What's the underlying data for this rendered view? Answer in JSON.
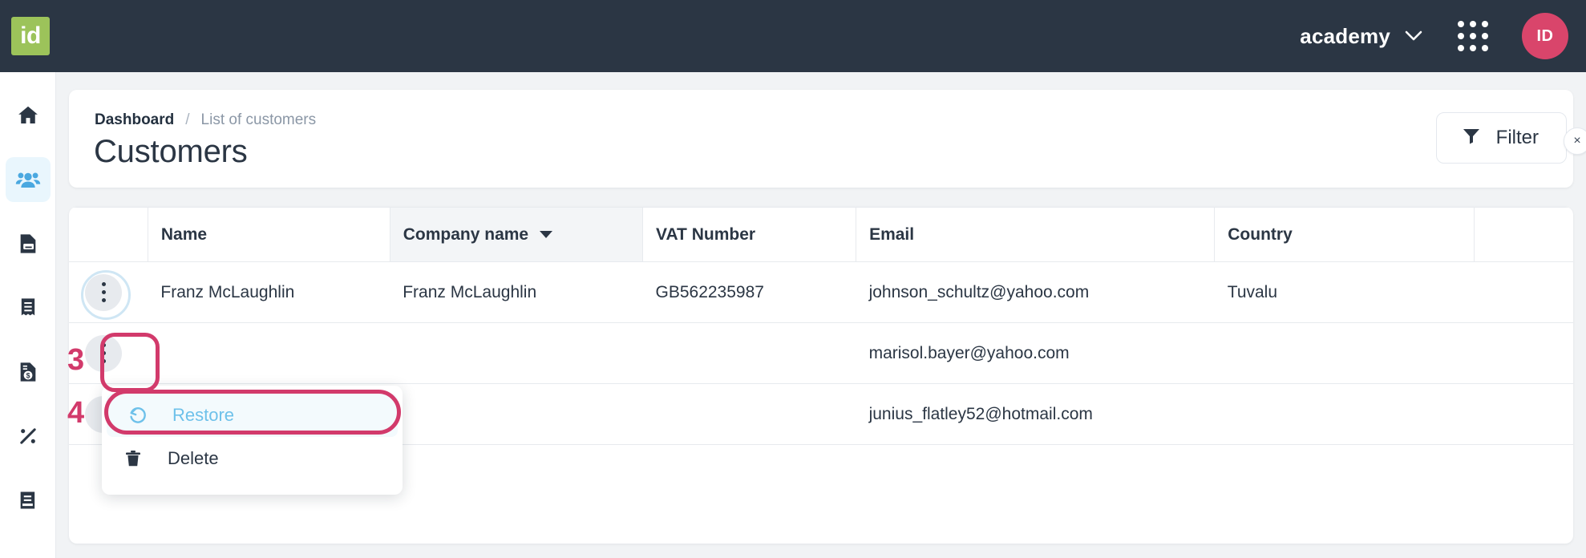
{
  "topbar": {
    "logo_text": "id",
    "org_name": "academy",
    "org_chevron_icon": "chevron-down-icon",
    "apps_icon": "grid-apps-icon",
    "avatar_initials": "ID",
    "avatar_color": "#d9456b",
    "logo_color": "#9cc35a",
    "background_color": "#2b3644"
  },
  "sidebar": {
    "items": [
      {
        "name": "home",
        "icon": "home-icon",
        "active": false
      },
      {
        "name": "customers",
        "icon": "people-icon",
        "active": true
      },
      {
        "name": "quotes",
        "icon": "document-icon",
        "active": false
      },
      {
        "name": "receipts",
        "icon": "receipt-icon",
        "active": false
      },
      {
        "name": "invoices",
        "icon": "invoice-dollar-icon",
        "active": false
      },
      {
        "name": "taxes",
        "icon": "percent-icon",
        "active": false
      },
      {
        "name": "ledger",
        "icon": "book-icon",
        "active": false
      }
    ],
    "active_color": "#4aa8e0",
    "active_background": "#e9f6fd"
  },
  "header": {
    "breadcrumb": {
      "root": "Dashboard",
      "separator": "/",
      "current": "List of customers"
    },
    "title": "Customers",
    "filter_button": {
      "label": "Filter",
      "icon": "funnel-icon",
      "clear_icon": "close-icon",
      "clear_label": "×"
    }
  },
  "table": {
    "columns": [
      {
        "key": "actions",
        "label": ""
      },
      {
        "key": "name",
        "label": "Name",
        "sorted": false
      },
      {
        "key": "company",
        "label": "Company name",
        "sorted": true,
        "sort_icon": "sort-desc-caret"
      },
      {
        "key": "vat",
        "label": "VAT Number",
        "sorted": false
      },
      {
        "key": "email",
        "label": "Email",
        "sorted": false
      },
      {
        "key": "country",
        "label": "Country",
        "sorted": false
      }
    ],
    "rows": [
      {
        "actions_icon": "kebab-menu-icon",
        "name": "Franz McLaughlin",
        "company": "Franz McLaughlin",
        "vat": "GB562235987",
        "email": "johnson_schultz@yahoo.com",
        "country": "Tuvalu"
      },
      {
        "actions_icon": "kebab-menu-icon",
        "name": "",
        "company": "",
        "vat": "",
        "email": "marisol.bayer@yahoo.com",
        "country": ""
      },
      {
        "actions_icon": "kebab-menu-icon",
        "name": "",
        "company": "",
        "vat": "",
        "email": "junius_flatley52@hotmail.com",
        "country": ""
      }
    ]
  },
  "context_menu": {
    "items": [
      {
        "label": "Restore",
        "icon": "undo-restore-icon",
        "highlighted": true,
        "color": "#6ec1ea"
      },
      {
        "label": "Delete",
        "icon": "trash-icon",
        "highlighted": false,
        "color": "#2b3644"
      }
    ]
  },
  "annotations": {
    "color": "#d23a6b",
    "steps": [
      {
        "number": "3",
        "target": "row-actions-kebab-button"
      },
      {
        "number": "4",
        "target": "context-menu-restore-item"
      }
    ]
  }
}
